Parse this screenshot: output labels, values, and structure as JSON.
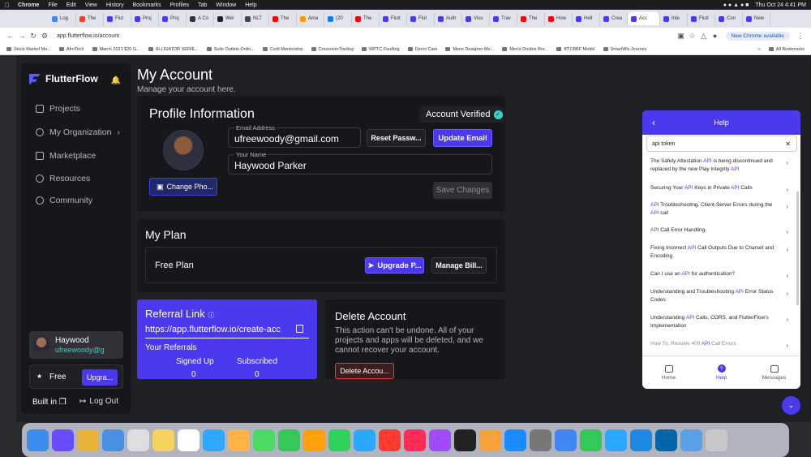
{
  "menubar": {
    "app": "Chrome",
    "menus": [
      "File",
      "Edit",
      "View",
      "History",
      "Bookmarks",
      "Profiles",
      "Tab",
      "Window",
      "Help"
    ],
    "clock": "Thu Oct 24  4:41 PM"
  },
  "tabs": [
    "Log",
    "The",
    "Flut",
    "Proj",
    "Proj",
    "A Co",
    "Wel",
    "NLT",
    "The",
    "Ama",
    "(20",
    "The",
    "Flutt",
    "Flut",
    "Auth",
    "Visu",
    "Trav",
    "The",
    "How",
    "Hell",
    "Crea",
    "Acc",
    "Inte",
    "FlutI",
    "Con",
    "New"
  ],
  "address": {
    "url": "app.flutterflow.io/account",
    "new_chrome": "New Chrome available"
  },
  "bookmarks": [
    "Stock Market Mo...",
    "AfroTech",
    "March 2021 $20 G...",
    "ALLIGATOR SERIE...",
    "Suits Outlets Onlin...",
    "Cortt Mentorship",
    "CrossoverTrading",
    "WPTC Funding",
    "Direct Care",
    "Mens Designer Mo...",
    "Men's Double Bre...",
    "BTCBBF Model",
    "SmartWiz Journey",
    "All Bookmarks"
  ],
  "sidebar": {
    "brand": "FlutterFlow",
    "items": [
      {
        "label": "Projects"
      },
      {
        "label": "My Organization"
      },
      {
        "label": "Marketplace"
      },
      {
        "label": "Resources"
      },
      {
        "label": "Community"
      }
    ],
    "user_name": "Haywood",
    "user_email": "ufreewoody@g",
    "plan": "Free",
    "upgrade": "Upgra...",
    "built_in": "Built in",
    "logout": "Log Out"
  },
  "main": {
    "title": "My Account",
    "subtitle": "Manage your account here.",
    "profile": {
      "title": "Profile Information",
      "verified": "Account Verified",
      "change_photo": "Change Pho...",
      "email_label": "Email Address",
      "email": "ufreewoody@gmail.com",
      "reset": "Reset Passw...",
      "update_email": "Update Email",
      "name_label": "Your Name",
      "name": "Haywood Parker",
      "save": "Save Changes"
    },
    "plan": {
      "title": "My Plan",
      "current": "Free Plan",
      "upgrade": "Upgrade P...",
      "manage": "Manage Bill..."
    },
    "referral": {
      "title": "Referral Link",
      "link": "https://app.flutterflow.io/create-acc",
      "your_referrals": "Your Referrals",
      "signed_up_label": "Signed Up",
      "subscribed_label": "Subscribed",
      "signed_up": "0",
      "subscribed": "0"
    },
    "delete": {
      "title": "Delete Account",
      "desc": "This action can't be undone. All of your projects and apps will be deleted, and we cannot recover your account.",
      "button": "Delete Accou..."
    }
  },
  "help": {
    "title": "Help",
    "search": "api token",
    "results": [
      "The Safety Attestation API is being discontinued and replaced by the new Play Integrity API",
      "Securing Your API Keys in Private API Calls",
      "API Troubleshooting, Client-Server Errors during the API call",
      "API Call Error Handling.",
      "Fixing Incorrect API Call Outputs Due to Charset and Encoding",
      "Can I use an API for authentication?",
      "Understanding and Troubleshooting API Error Status Codes",
      "Understanding API Calls, CORS, and FlutterFlow's Implementation",
      "How To: Resolve 400 API Call Errors"
    ],
    "footer": {
      "home": "Home",
      "help": "Help",
      "messages": "Messages"
    }
  },
  "colors": {
    "accent": "#4b39ef",
    "teal": "#39d2c0",
    "danger": "#ef3939"
  }
}
